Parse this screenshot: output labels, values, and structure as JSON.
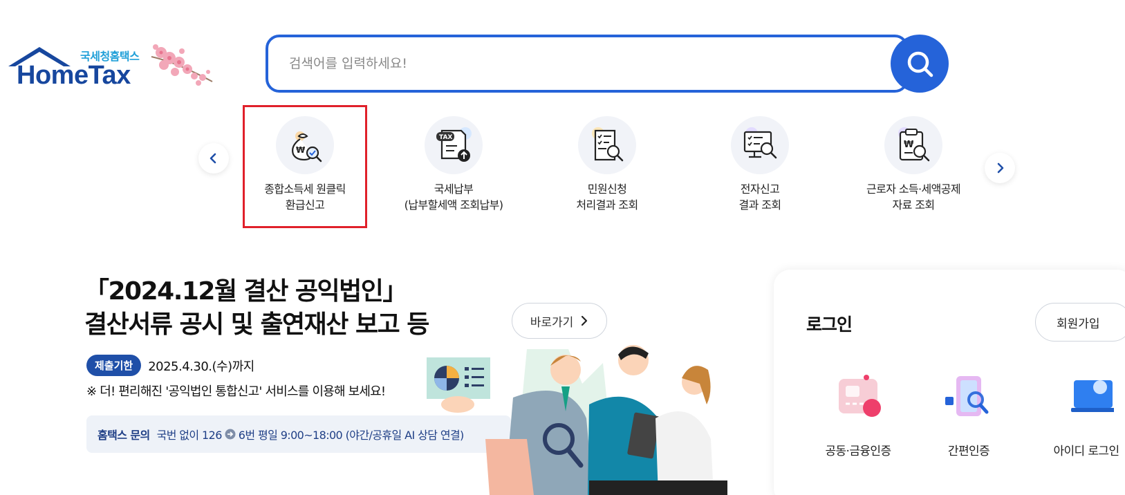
{
  "logo": {
    "subtitle": "국세청홈택스",
    "name": "HomeTax"
  },
  "search": {
    "placeholder": "검색어를 입력하세요!"
  },
  "quick_menu": [
    {
      "line1": "종합소득세 원클릭",
      "line2": "환급신고",
      "icon": "money-bag-search-icon",
      "selected": true
    },
    {
      "line1": "국세납부",
      "line2": "(납부할세액 조회납부)",
      "icon": "tax-document-upload-icon",
      "selected": false
    },
    {
      "line1": "민원신청",
      "line2": "처리결과 조회",
      "icon": "checklist-search-icon",
      "selected": false
    },
    {
      "line1": "전자신고",
      "line2": "결과 조회",
      "icon": "monitor-search-icon",
      "selected": false
    },
    {
      "line1": "근로자 소득·세액공제",
      "line2": "자료 조회",
      "icon": "clipboard-search-icon",
      "selected": false
    }
  ],
  "banner": {
    "title_line1": "「2024.12월 결산 공익법인」",
    "title_line2": "결산서류 공시 및 출연재산 보고 등",
    "goto_label": "바로가기",
    "badge": "제출기한",
    "deadline": "2025.4.30.(수)까지",
    "notice": "※ 더! 편리해진 '공익법인 통합신고' 서비스를 이용해 보세요!",
    "contact_label": "홈택스 문의",
    "contact_text_1": "국번 없이 126",
    "contact_text_2": "6번 평일 9:00~18:00 (야간/공휴일 AI 상담 연결)"
  },
  "login": {
    "title": "로그인",
    "join_label": "회원가입",
    "options": [
      {
        "label": "공동·금융인증",
        "icon": "certificate-card-icon"
      },
      {
        "label": "간편인증",
        "icon": "phone-search-icon"
      },
      {
        "label": "아이디 로그인",
        "icon": "id-login-icon"
      }
    ]
  },
  "colors": {
    "primary": "#2563d9",
    "logo_blue": "#17479e",
    "badge": "#1f4fa8",
    "highlight": "#e0202a"
  }
}
